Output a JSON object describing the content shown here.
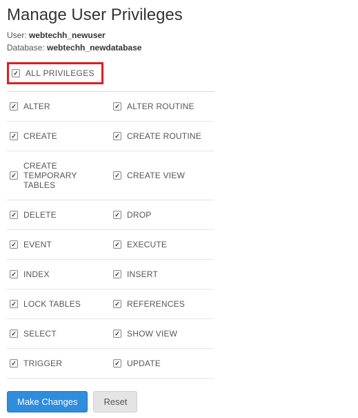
{
  "title": "Manage User Privileges",
  "meta": {
    "user_label": "User:",
    "user_value": "webtechh_newuser",
    "db_label": "Database:",
    "db_value": "webtechh_newdatabase"
  },
  "all_privileges": {
    "label": "ALL PRIVILEGES",
    "checked": true
  },
  "privileges": [
    {
      "left": {
        "label": "ALTER",
        "checked": true
      },
      "right": {
        "label": "ALTER ROUTINE",
        "checked": true
      }
    },
    {
      "left": {
        "label": "CREATE",
        "checked": true
      },
      "right": {
        "label": "CREATE ROUTINE",
        "checked": true
      }
    },
    {
      "left": {
        "label": "CREATE TEMPORARY TABLES",
        "checked": true
      },
      "right": {
        "label": "CREATE VIEW",
        "checked": true
      }
    },
    {
      "left": {
        "label": "DELETE",
        "checked": true
      },
      "right": {
        "label": "DROP",
        "checked": true
      }
    },
    {
      "left": {
        "label": "EVENT",
        "checked": true
      },
      "right": {
        "label": "EXECUTE",
        "checked": true
      }
    },
    {
      "left": {
        "label": "INDEX",
        "checked": true
      },
      "right": {
        "label": "INSERT",
        "checked": true
      }
    },
    {
      "left": {
        "label": "LOCK TABLES",
        "checked": true
      },
      "right": {
        "label": "REFERENCES",
        "checked": true
      }
    },
    {
      "left": {
        "label": "SELECT",
        "checked": true
      },
      "right": {
        "label": "SHOW VIEW",
        "checked": true
      }
    },
    {
      "left": {
        "label": "TRIGGER",
        "checked": true
      },
      "right": {
        "label": "UPDATE",
        "checked": true
      }
    }
  ],
  "actions": {
    "primary": "Make Changes",
    "reset": "Reset"
  }
}
